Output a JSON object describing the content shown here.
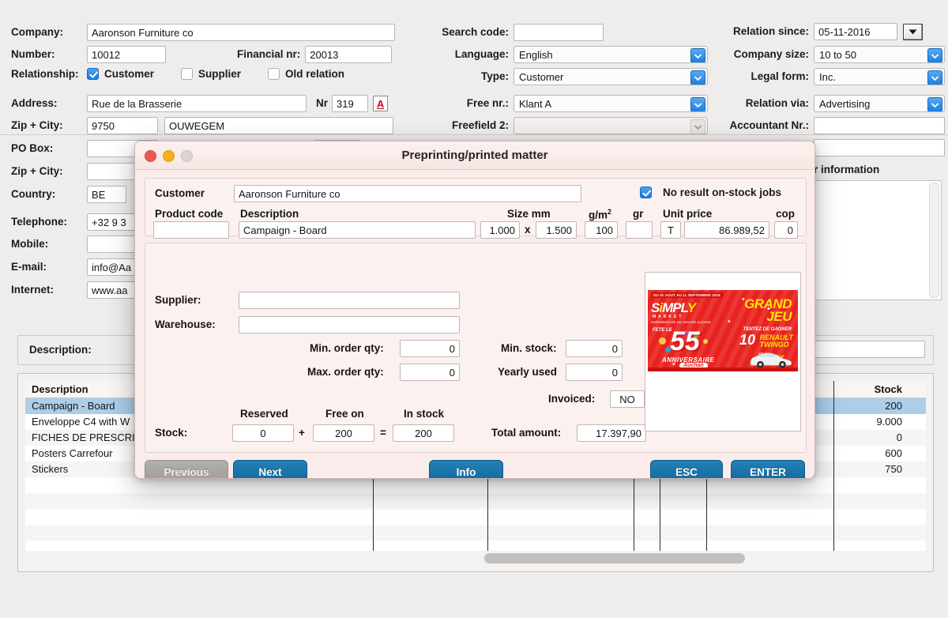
{
  "background_form": {
    "left_column": [
      {
        "label": "Company:",
        "value": "Aaronson Furniture co"
      },
      {
        "label": "Number:",
        "value": "10012"
      },
      {
        "label": "Relationship:",
        "value": ""
      },
      {
        "label": "Address:",
        "value": "Rue de la Brasserie"
      },
      {
        "label": "Zip + City:",
        "value": "9750"
      },
      {
        "label": "PO Box:",
        "value": ""
      },
      {
        "label": "Zip + City:",
        "value": ""
      },
      {
        "label": "Country:",
        "value": "BE"
      },
      {
        "label": "Telephone:",
        "value": "+32 9 3"
      },
      {
        "label": "Mobile:",
        "value": ""
      },
      {
        "label": "E-mail:",
        "value": "info@Aa"
      },
      {
        "label": "Internet:",
        "value": "www.aa"
      }
    ],
    "financial_nr": {
      "label": "Financial nr:",
      "value": "20013"
    },
    "city_value": "OUWEGEM",
    "address_nr": {
      "label": "Nr",
      "value": "319"
    },
    "address_icon": "A",
    "relationship": {
      "label": "Relationship:",
      "options": [
        {
          "label": "Customer",
          "checked": true
        },
        {
          "label": "Supplier",
          "checked": false
        },
        {
          "label": "Old relation",
          "checked": false
        }
      ]
    },
    "middle_column": [
      {
        "label": "Search code:",
        "value": "",
        "type": "text"
      },
      {
        "label": "Language:",
        "value": "English",
        "type": "combo"
      },
      {
        "label": "Type:",
        "value": "Customer",
        "type": "combo"
      },
      {
        "label": "Free nr.:",
        "value": "Klant A",
        "type": "combo"
      },
      {
        "label": "Freefield 2:",
        "value": "",
        "type": "combo-dim"
      }
    ],
    "right_column": [
      {
        "label": "Relation since:",
        "value": "05-11-2016",
        "type": "date"
      },
      {
        "label": "Company size:",
        "value": "10 to 50",
        "type": "combo"
      },
      {
        "label": "Legal form:",
        "value": "Inc.",
        "type": "combo"
      },
      {
        "label": "Relation via:",
        "value": "Advertising",
        "type": "combo"
      },
      {
        "label": "Accountant Nr.:",
        "value": "",
        "type": "text"
      },
      {
        "label": "",
        "value": "",
        "type": "text"
      }
    ],
    "info_panel_label": "r information",
    "description_label": "Description:"
  },
  "product_table": {
    "columns": [
      {
        "key": "description",
        "label": "Description"
      },
      {
        "key": "stock",
        "label": "Stock"
      }
    ],
    "rows": [
      {
        "description": "Campaign - Board",
        "stock": "200",
        "selected": true
      },
      {
        "description": "Enveloppe C4 with W",
        "stock": "9.000",
        "selected": false
      },
      {
        "description": "FICHES DE PRESCRIP",
        "stock": "0",
        "selected": false
      },
      {
        "description": "Posters Carrefour",
        "stock": "600",
        "selected": false
      },
      {
        "description": "Stickers",
        "stock": "750",
        "selected": false
      }
    ]
  },
  "dialog": {
    "title": "Preprinting/printed matter",
    "traffic_lights": [
      "close-button",
      "minimize-button",
      "zoom-button"
    ],
    "customer": {
      "label": "Customer",
      "value": "Aaronson Furniture co"
    },
    "no_result_checkbox": {
      "label": "No result on-stock jobs",
      "checked": true
    },
    "product_headers": {
      "product_code": "Product code",
      "description": "Description",
      "size_mm": "Size mm",
      "gsm": "g/m",
      "gsm_sup": "2",
      "gr": "gr",
      "unit_price": "Unit price",
      "cop": "cop"
    },
    "product_row": {
      "product_code": "",
      "description": "Campaign - Board",
      "size_w": "1.000",
      "size_sep": "x",
      "size_h": "1.500",
      "gsm": "100",
      "gr": "",
      "unit_prefix": "T",
      "unit_price": "86.989,52",
      "cop": "0"
    },
    "supplier": {
      "label": "Supplier:",
      "value": ""
    },
    "warehouse": {
      "label": "Warehouse:",
      "value": ""
    },
    "qty_fields": [
      {
        "label": "Min. order qty:",
        "value": "0"
      },
      {
        "label": "Max. order qty:",
        "value": "0"
      }
    ],
    "stock_fields": [
      {
        "label": "Min. stock:",
        "value": "0"
      },
      {
        "label": "Yearly used",
        "value": "0"
      },
      {
        "label": "Invoiced:",
        "value": "NO"
      }
    ],
    "stock_row": {
      "label": "Stock:",
      "headers": {
        "reserved": "Reserved",
        "free_on": "Free on",
        "in_stock": "In stock"
      },
      "reserved": "0",
      "plus": "+",
      "free_on": "200",
      "equals": "=",
      "in_stock": "200"
    },
    "total_amount": {
      "label": "Total amount:",
      "value": "17.397,90"
    },
    "product_image": {
      "alt": "SIMPLY MARKET promotional banner",
      "date_line": "DU 31 AOUT AU 11 SEPTEMBRE 2016",
      "brand": "SIMPLY",
      "brand_accent": "MARKET",
      "brand_sub": "SUPERMARCHE DU GROUPE AUCHAN",
      "fete": "FETE LE",
      "number": "55",
      "anniversaire": "ANNIVERSAIRE",
      "auchan": "Auchan",
      "grand_jeu": "GRAND JEU",
      "tentez": "TENTEZ DE GAGNER",
      "count": "10",
      "prize": "RENAULT TWINGO",
      "chez": "chez",
      "chez_brand": "SIMPLY"
    },
    "buttons": {
      "previous": {
        "label": "Previous",
        "disabled": true
      },
      "next": {
        "label": "Next",
        "disabled": false
      },
      "info": {
        "label": "Info",
        "disabled": false
      },
      "esc": {
        "label": "ESC",
        "disabled": false
      },
      "enter": {
        "label": "ENTER",
        "disabled": false
      }
    }
  },
  "colors": {
    "accent_blue": "#1878dc",
    "button_blue": "#10699d",
    "selection_blue": "#accee9",
    "dialog_bg": "#f9ecea",
    "banner_red": "#e8231f",
    "banner_yellow": "#ffe400"
  }
}
